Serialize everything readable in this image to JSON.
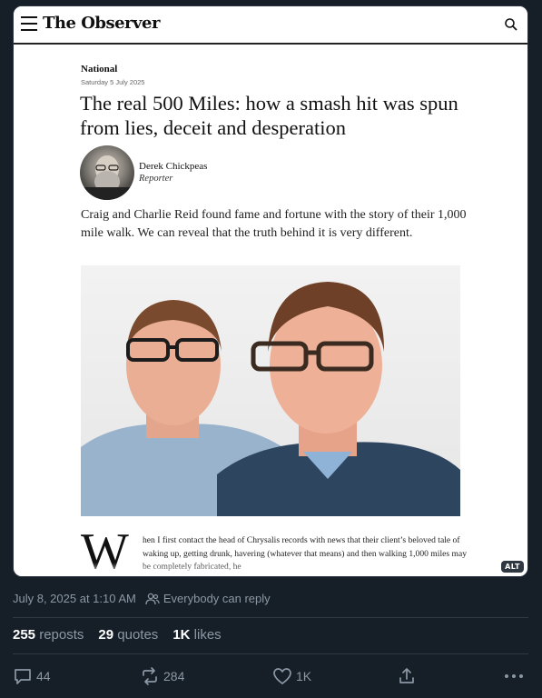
{
  "publication": {
    "logo_text": "The Observer",
    "icons": {
      "menu": "hamburger-icon",
      "search": "search-icon"
    }
  },
  "article": {
    "section": "National",
    "date": "Saturday 5 July 2025",
    "headline": "The real 500 Miles: how a smash hit was spun from lies, deceit and desperation",
    "author": {
      "name": "Derek Chickpeas",
      "role": "Reporter"
    },
    "standfirst": "Craig and Charlie Reid found fame and fortune with the story of their 1,000 mile walk. We can reveal that the truth behind it is very different.",
    "dropcap": "W",
    "body": "hen I first contact the head of Chrysalis records with news that their client’s beloved tale of waking up, getting drunk, havering (whatever that means) and then walking 1,000 miles may be completely fabricated, he"
  },
  "media": {
    "alt_badge": "ALT"
  },
  "post": {
    "timestamp": "July 8, 2025 at 1:10 AM",
    "reply_setting": "Everybody can reply",
    "stats": {
      "reposts_count": "255",
      "reposts_label": "reposts",
      "quotes_count": "29",
      "quotes_label": "quotes",
      "likes_count": "1K",
      "likes_label": "likes"
    },
    "actions": {
      "replies": "44",
      "reposts": "284",
      "likes": "1K"
    }
  },
  "colors": {
    "background": "#161e27",
    "muted_text": "#8b98a5",
    "divider": "#2f3943"
  }
}
